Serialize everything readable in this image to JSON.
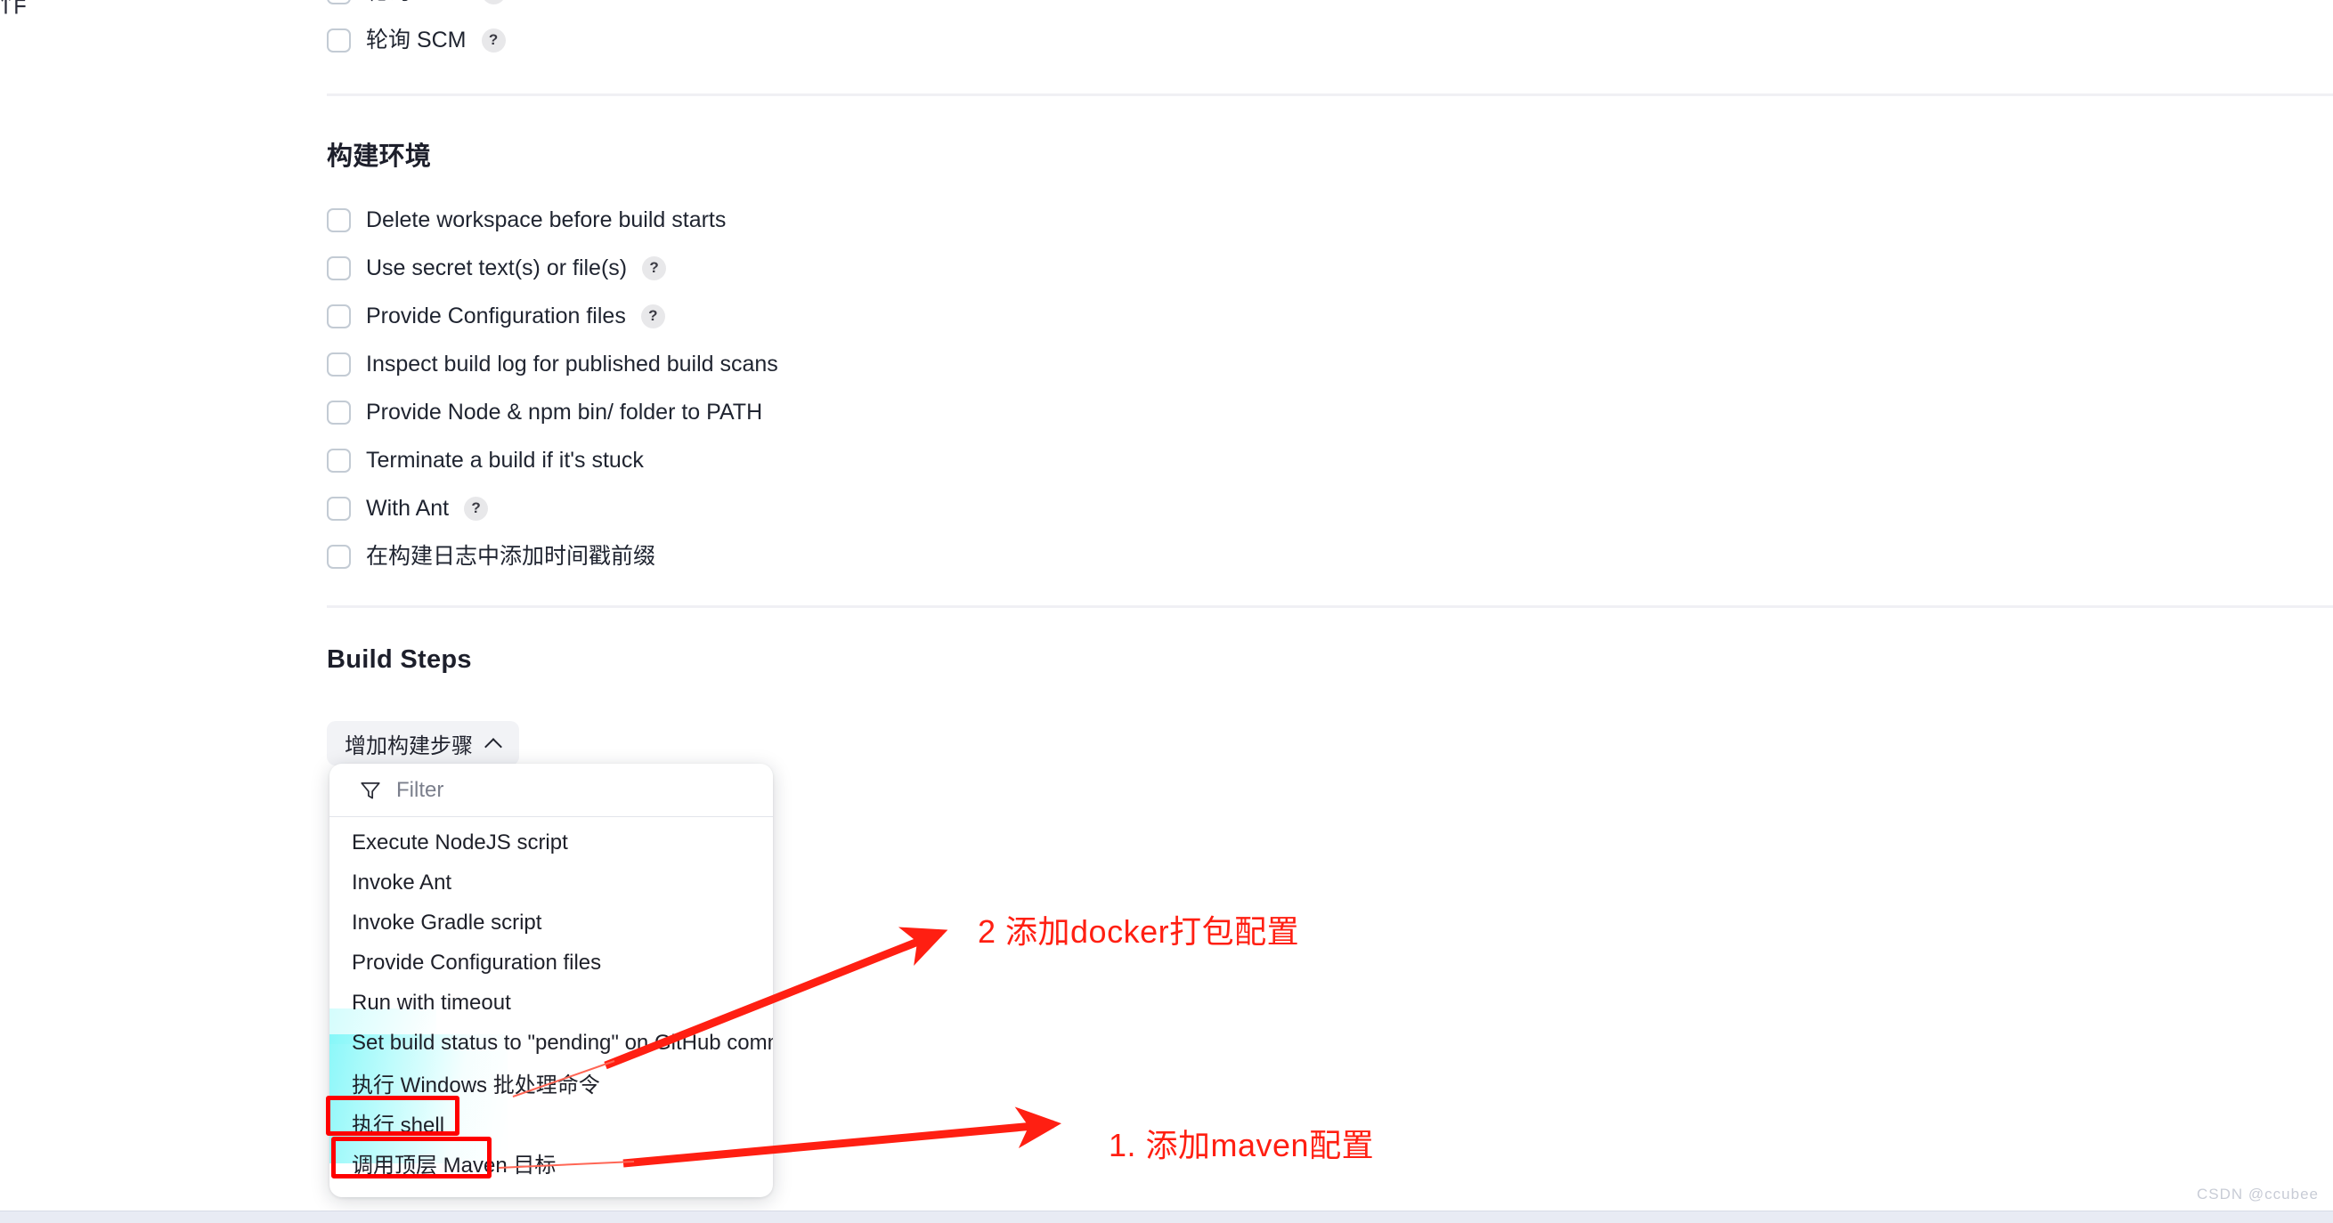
{
  "page": {
    "clipped_fragment": "作",
    "watermark": "CSDN @ccubee"
  },
  "triggers_section": {
    "clipped_row": {
      "label": "轮询 SCM",
      "help": "?"
    }
  },
  "build_environment": {
    "heading": "构建环境",
    "options": [
      {
        "label": "Delete workspace before build starts",
        "help": null
      },
      {
        "label": "Use secret text(s) or file(s)",
        "help": "?"
      },
      {
        "label": "Provide Configuration files",
        "help": "?"
      },
      {
        "label": "Inspect build log for published build scans",
        "help": null
      },
      {
        "label": "Provide Node & npm bin/ folder to PATH",
        "help": null
      },
      {
        "label": "Terminate a build if it's stuck",
        "help": null
      },
      {
        "label": "With Ant",
        "help": "?"
      },
      {
        "label": "在构建日志中添加时间戳前缀",
        "help": null
      }
    ]
  },
  "build_steps": {
    "heading": "Build Steps",
    "add_button": {
      "label": "增加构建步骤",
      "chevron_icon": "chevron-up-icon"
    },
    "dropdown": {
      "filter_placeholder": "Filter",
      "filter_icon": "funnel-icon",
      "items": [
        {
          "label": "Execute NodeJS script",
          "highlighted": false
        },
        {
          "label": "Invoke Ant",
          "highlighted": false
        },
        {
          "label": "Invoke Gradle script",
          "highlighted": false
        },
        {
          "label": "Provide Configuration files",
          "highlighted": false
        },
        {
          "label": "Run with timeout",
          "highlighted": true
        },
        {
          "label": "Set build status to \"pending\" on GitHub commit",
          "highlighted": true
        },
        {
          "label": "执行 Windows 批处理命令",
          "highlighted": true
        },
        {
          "label": "执行 shell",
          "highlighted": false
        },
        {
          "label": "调用顶层 Maven 目标",
          "highlighted": false
        }
      ]
    }
  },
  "annotations": {
    "accent_color": "#ff1f12",
    "box_color": "#ff0000",
    "callouts": [
      {
        "text": "2 添加docker打包配置",
        "points_to": "Set build status to \"pending\" on GitHub commit"
      },
      {
        "text": "1. 添加maven配置",
        "points_to": "调用顶层 Maven 目标"
      }
    ]
  }
}
